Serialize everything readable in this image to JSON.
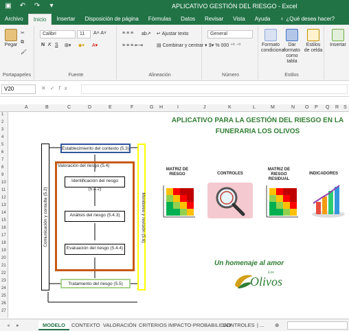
{
  "window": {
    "title": "APLICATIVO GESTIÓN DEL RIESGO - Excel"
  },
  "ribbon_tabs": [
    "Archivo",
    "Inicio",
    "Insertar",
    "Disposición de página",
    "Fórmulas",
    "Datos",
    "Revisar",
    "Vista",
    "Ayuda"
  ],
  "tell_me": "¿Qué desea hacer?",
  "clipboard": {
    "paste": "Pegar",
    "label": "Portapapeles"
  },
  "font": {
    "name": "Calibri",
    "size": "11",
    "label": "Fuente",
    "bold": "N",
    "italic": "K",
    "underline": "S"
  },
  "alignment": {
    "wrap": "Ajustar texto",
    "merge": "Combinar y centrar",
    "label": "Alineación"
  },
  "number": {
    "format": "General",
    "label": "Número"
  },
  "styles": {
    "conditional": "Formato condicional",
    "as_table": "Dar formato como tabla",
    "cell_styles": "Estilos de celda",
    "label": "Estilos"
  },
  "insert_button": "Insertar",
  "formula_bar": {
    "cell": "V20",
    "value": ""
  },
  "columns": [
    "A",
    "B",
    "C",
    "D",
    "E",
    "F",
    "G",
    "H",
    "I",
    "J",
    "K",
    "L",
    "M",
    "N",
    "O",
    "P",
    "Q",
    "R",
    "S"
  ],
  "rows": [
    "1",
    "2",
    "3",
    "4",
    "5",
    "6",
    "7",
    "8",
    "9",
    "10",
    "11",
    "12",
    "13",
    "14",
    "15",
    "16",
    "17",
    "18",
    "19",
    "20",
    "21",
    "22",
    "23",
    "24",
    "25",
    "26",
    "27"
  ],
  "sheet_title": "APLICATIVO PARA LA GESTIÓN DEL RIESGO EN LA FUNERARIA LOS OLIVOS",
  "diagram": {
    "context": "Establecimiento del contexto (5.3)",
    "assessment": "Valoración del riesgo (5.4)",
    "identification": "Identificación del riesgo (5.4.2)",
    "analysis": "Análisis del riesgo (5.4.3)",
    "evaluation": "Evaluación del riesgo (5.4.4)",
    "treatment": "Tratamiento del riesgo (5.5)",
    "communication": "Comunicación y consulta (5.2)",
    "monitoring": "Monitoreo y revisión (5.6)"
  },
  "menu": [
    {
      "label": "MATRIZ DE RIESGO",
      "icon": "risk-matrix-icon"
    },
    {
      "label": "CONTROLES",
      "icon": "magnifier-icon"
    },
    {
      "label": "MATRIZ DE RIESGO RESIDUAL",
      "icon": "residual-matrix-icon"
    },
    {
      "label": "INDICADORES",
      "icon": "bar-chart-icon"
    }
  ],
  "homage": "Un homenaje al amor",
  "logo": {
    "small": "Los",
    "big": "Olivos"
  },
  "sheet_tabs": [
    "MODELO",
    "CONTEXTO",
    "VALORACIÓN",
    "CRITERIOS IMPACTO-PROBABILIDAD",
    "CONTROLES"
  ],
  "sheet_tabs_more": "...",
  "colors": {
    "excel_green": "#217346",
    "title_green": "#2f7d32",
    "orange": "#c65911",
    "yellow": "#ffff00",
    "blue": "#2f5597",
    "green_box": "#a9d18e"
  }
}
